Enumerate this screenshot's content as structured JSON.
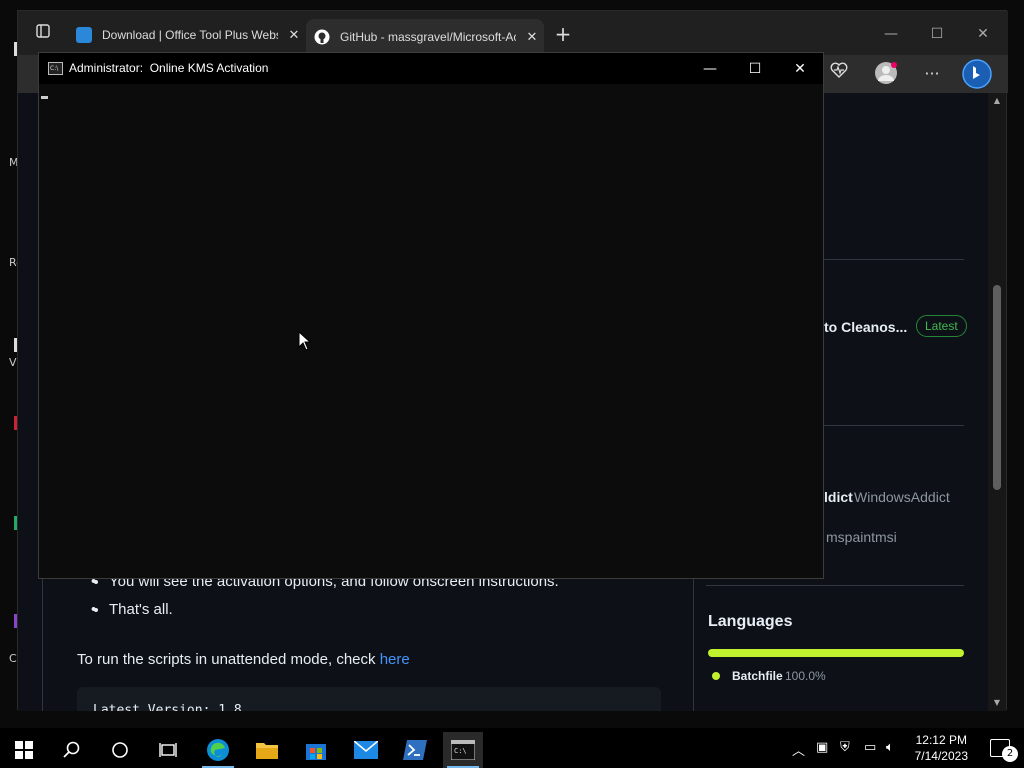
{
  "desktop": {
    "strip_texts": [
      "M",
      "Re",
      "V",
      "C"
    ]
  },
  "browser": {
    "tabs": [
      {
        "title": "Download | Office Tool Plus Website",
        "favicon": "office-favicon",
        "color": "#2b88d8"
      },
      {
        "title": "GitHub - massgravel/Microsoft-Activation-Scripts",
        "favicon": "github-favicon",
        "color": "#ffffff"
      }
    ],
    "new_tab": "+"
  },
  "console": {
    "user": "Administrator:",
    "title": "Online KMS Activation"
  },
  "readme": {
    "bullets": [
      "You will see the activation options, and follow onscreen instructions.",
      "That's all."
    ],
    "unattended_prefix": "To run the scripts in unattended mode, check ",
    "unattended_link": "here",
    "code": "Latest Version: 1.8"
  },
  "sidebar": {
    "release_name": "to Cleanos...",
    "latest_badge": "Latest",
    "contributor1_bold": "ldict",
    "contributor1_name": "WindowsAddict",
    "contributor2_name": "mspaintmsi",
    "languages_heading": "Languages",
    "language_name": "Batchfile",
    "language_percent": "100.0%",
    "language_color": "#c1f12e"
  },
  "taskbar": {
    "time": "12:12 PM",
    "date": "7/14/2023",
    "notification_count": "2",
    "apps": [
      "start-button",
      "search-button",
      "cortana-button",
      "task-view-button",
      "edge-app",
      "file-explorer-app",
      "store-app",
      "mail-app",
      "powershell-app",
      "cmd-app"
    ]
  }
}
